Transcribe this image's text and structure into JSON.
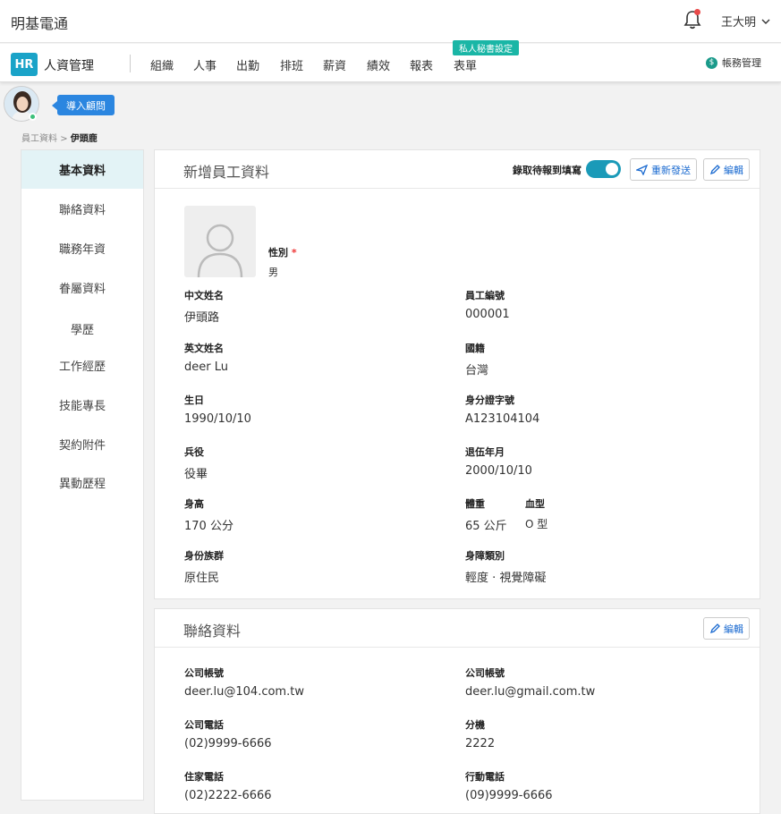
{
  "topbar": {
    "company": "明基電通",
    "user_name": "王大明"
  },
  "nav": {
    "app_logo": "HR",
    "app_name": "人資管理",
    "menu": [
      "組織",
      "人事",
      "出勤",
      "排班",
      "薪資",
      "績效",
      "報表",
      "表單"
    ],
    "badge": "私人秘書設定",
    "account_icon": "$",
    "account": "帳務管理"
  },
  "consult_label": "導入顧問",
  "breadcrumb": {
    "parent": "員工資料",
    "separator": ">",
    "current": "伊頭鹿"
  },
  "sidebar": {
    "items": [
      {
        "label": "基本資料",
        "active": true
      },
      {
        "label": "聯絡資料"
      },
      {
        "label": "職務年資"
      },
      {
        "label": "眷屬資料"
      },
      {
        "label": "學歷"
      },
      {
        "label": "工作經歷"
      },
      {
        "label": "技能專長"
      },
      {
        "label": "契約附件"
      },
      {
        "label": "異動歷程"
      }
    ]
  },
  "basic": {
    "title": "新增員工資料",
    "toggle_label": "錄取待報到填寫",
    "toggle_on": true,
    "resend_label": "重新發送",
    "edit_label": "編輯",
    "gender_label": "性別",
    "gender_required": "*",
    "gender_value": "男",
    "fields": {
      "cn_name": {
        "label": "中文姓名",
        "value": "伊頭路"
      },
      "emp_no": {
        "label": "員工編號",
        "value": "000001"
      },
      "en_name": {
        "label": "英文姓名",
        "value": "deer Lu"
      },
      "nationality": {
        "label": "國籍",
        "value": "台灣"
      },
      "birthday": {
        "label": "生日",
        "value": "1990/10/10"
      },
      "id_no": {
        "label": "身分證字號",
        "value": "A123104104"
      },
      "military": {
        "label": "兵役",
        "value": "役畢"
      },
      "discharge": {
        "label": "退伍年月",
        "value": "2000/10/10"
      },
      "height": {
        "label": "身高",
        "value": "170 公分"
      },
      "weight": {
        "label": "體重",
        "value": "65 公斤"
      },
      "blood": {
        "label": "血型",
        "value": "O 型"
      },
      "ethnic": {
        "label": "身份族群",
        "value": "原住民"
      },
      "disability": {
        "label": "身障類別",
        "value": "輕度 · 視覺障礙"
      }
    }
  },
  "contact": {
    "title": "聯絡資料",
    "edit_label": "編輯",
    "fields": {
      "company_account": {
        "label": "公司帳號",
        "value": "deer.lu@104.com.tw"
      },
      "personal_account": {
        "label": "公司帳號",
        "value": "deer.lu@gmail.com.tw"
      },
      "company_phone": {
        "label": "公司電話",
        "value": "(02)9999-6666"
      },
      "extension": {
        "label": "分機",
        "value": "2222"
      },
      "home_phone": {
        "label": "住家電話",
        "value": "(02)2222-6666"
      },
      "mobile": {
        "label": "行動電話",
        "value": "(09)9999-6666"
      }
    }
  },
  "colors": {
    "accent": "#1a9ab8",
    "link": "#1a6ad0",
    "badge": "#1ab6a6",
    "consult": "#2b86e0"
  }
}
